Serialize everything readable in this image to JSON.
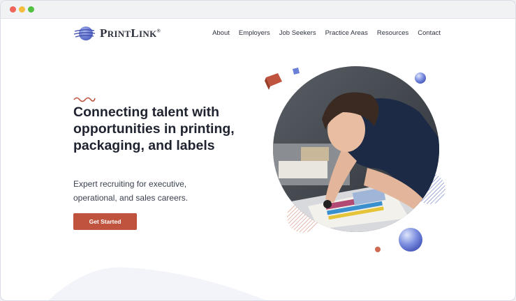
{
  "window": {
    "controls": [
      "close",
      "minimize",
      "maximize"
    ]
  },
  "brand": {
    "name_prefix": "P",
    "name_small": "RINT",
    "name_mid": "L",
    "name_small2": "INK",
    "registered": "®",
    "logo_icon": "globe-swoosh-icon"
  },
  "nav": {
    "items": [
      "About",
      "Employers",
      "Job Seekers",
      "Practice Areas",
      "Resources",
      "Contact"
    ]
  },
  "hero": {
    "headline": "Connecting talent with opportunities in printing, packaging, and labels",
    "subheadline": "Expert recruiting for executive, operational, and sales careers.",
    "cta_label": "Get Started",
    "image_description_icon": "press-operator-photo"
  },
  "colors": {
    "accent": "#c0533d",
    "text_dark": "#1f2330",
    "sphere_blue": "#6a7fd6"
  }
}
